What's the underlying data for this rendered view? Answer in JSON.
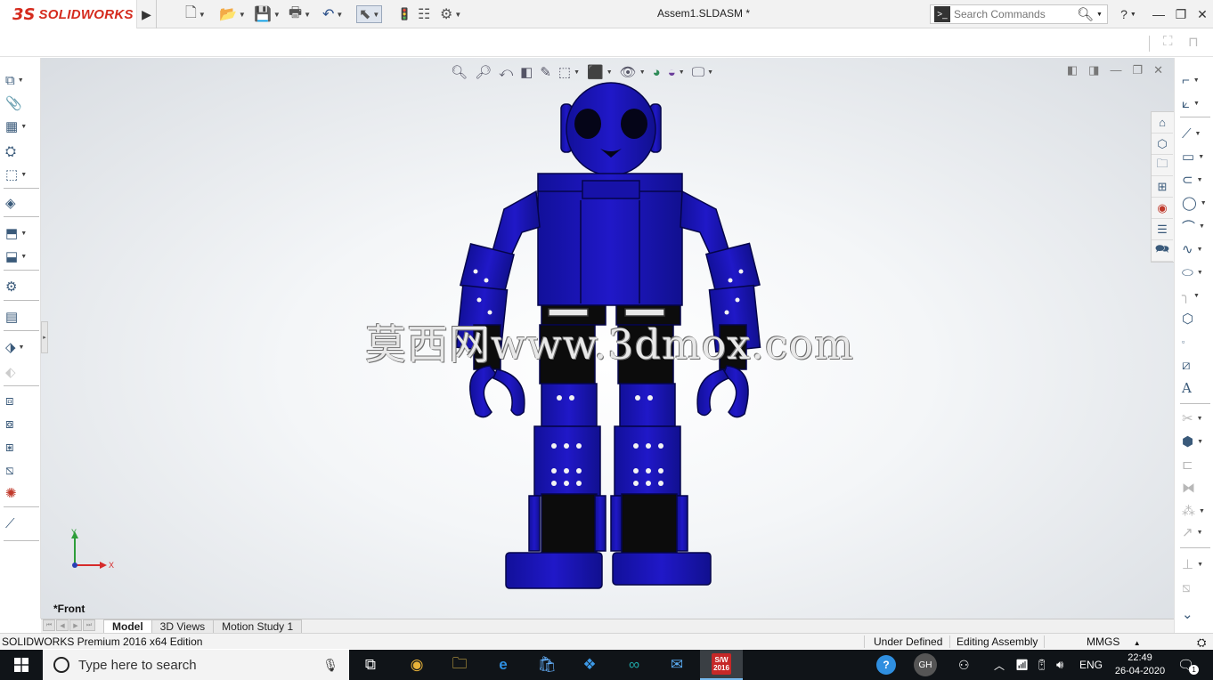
{
  "app": {
    "brand_mark": "3S",
    "brand_name": "SOLIDWORKS",
    "document_title": "Assem1.SLDASM *"
  },
  "titlebar": {
    "search_placeholder": "Search Commands",
    "help_label": "?",
    "icons": [
      "new-document-icon",
      "open-icon",
      "save-icon",
      "print-icon",
      "undo-icon",
      "select-icon",
      "rebuild-icon",
      "file-properties-icon",
      "options-icon"
    ]
  },
  "viewport": {
    "view_name": "*Front",
    "watermark": "莫西网www.3dmox.com",
    "triad": {
      "y_label": "Y",
      "x_label": "X"
    },
    "model_colors": {
      "body": "#1a13b5",
      "dark_parts": "#0b0b0b",
      "outline": "#05054a"
    }
  },
  "tabs": [
    {
      "label": "Model",
      "active": true
    },
    {
      "label": "3D Views",
      "active": false
    },
    {
      "label": "Motion Study 1",
      "active": false
    }
  ],
  "status_bar": {
    "edition": "SOLIDWORKS Premium 2016 x64 Edition",
    "definition_state": "Under Defined",
    "mode": "Editing Assembly",
    "units": "MMGS",
    "units_caret": "▲"
  },
  "taskbar": {
    "search_placeholder": "Type here to search",
    "user_initials": "GH",
    "language": "ENG",
    "time": "22:49",
    "date": "26-04-2020",
    "notification_count": "1",
    "sw_badge": "2016"
  }
}
